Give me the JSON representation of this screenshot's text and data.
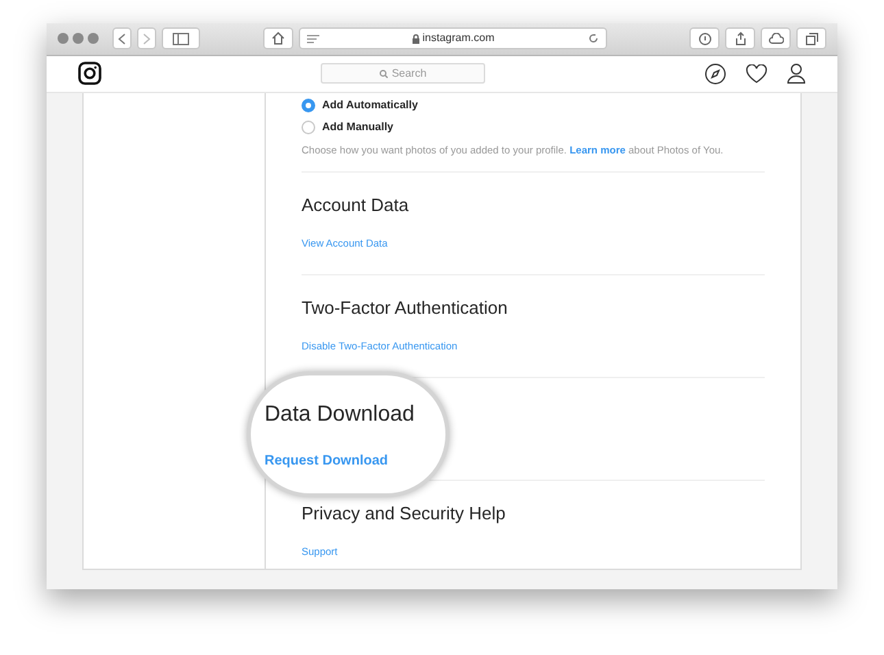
{
  "browser": {
    "address": "instagram.com"
  },
  "header": {
    "search_placeholder": "Search"
  },
  "photos_of_you": {
    "options": [
      {
        "label": "Add Automatically",
        "selected": true
      },
      {
        "label": "Add Manually",
        "selected": false
      }
    ],
    "description": "Choose how you want photos of you added to your profile.",
    "link": "Learn more",
    "description_end": "about Photos of You."
  },
  "sections": [
    {
      "kind": "plain",
      "heading": "Account Data",
      "link": "View Account Data"
    },
    {
      "kind": "plain",
      "heading": "Two-Factor Authentication",
      "link": "Disable Two-Factor Authentication"
    },
    {
      "kind": "magnified",
      "heading": "Data Download",
      "link": "Request Download"
    },
    {
      "kind": "plain",
      "heading": "Privacy and Security Help",
      "link": "Support"
    }
  ]
}
